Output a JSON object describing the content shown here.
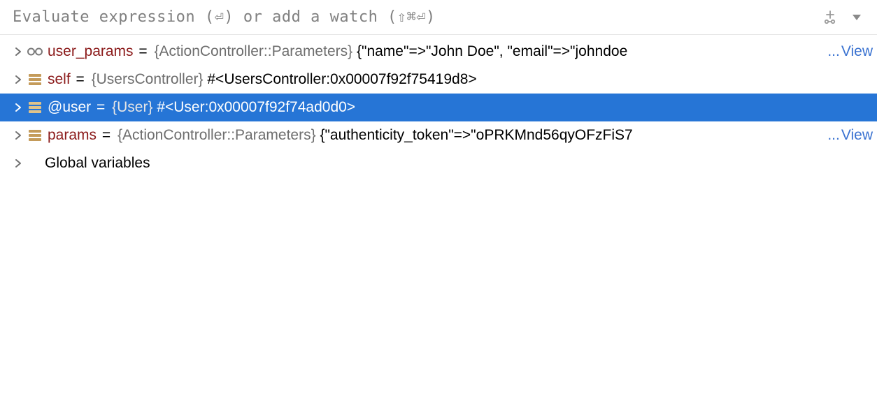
{
  "header": {
    "placeholder": "Evaluate expression (⏎) or add a watch (⇧⌘⏎)"
  },
  "rows": [
    {
      "icon": "glasses",
      "name": "user_params",
      "type": "{ActionController::Parameters}",
      "value": "{\"name\"=>\"John Doe\", \"email\"=>\"johndoe",
      "ellipsis": "...",
      "view": "View",
      "selected": false
    },
    {
      "icon": "bars",
      "name": "self",
      "type": "{UsersController}",
      "value": "#<UsersController:0x00007f92f75419d8>",
      "selected": false
    },
    {
      "icon": "bars",
      "name": "@user",
      "type": "{User}",
      "value": "#<User:0x00007f92f74ad0d0>",
      "selected": true
    },
    {
      "icon": "bars",
      "name": "params",
      "type": "{ActionController::Parameters}",
      "value": "{\"authenticity_token\"=>\"oPRKMnd56qyOFzFiS7",
      "ellipsis": "...",
      "view": "View",
      "selected": false
    },
    {
      "icon": "none",
      "plain": "Global variables",
      "selected": false
    }
  ]
}
